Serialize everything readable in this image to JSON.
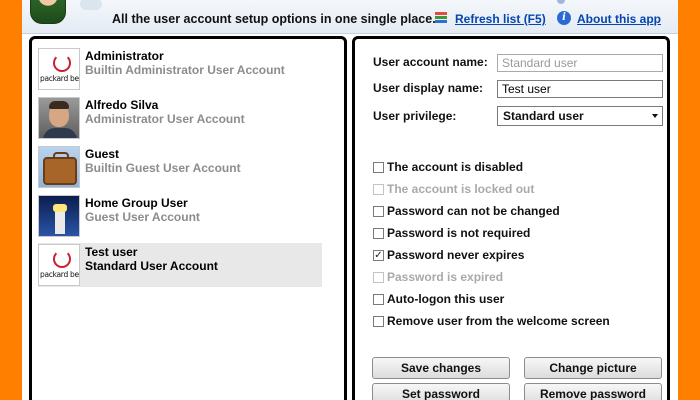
{
  "header": {
    "subtitle": "All the user account setup options in one single place.",
    "refresh_label": "Refresh list (F5)",
    "about_label": "About this app"
  },
  "users": [
    {
      "name": "Administrator",
      "description": "Builtin Administrator User Account",
      "image": "packard-bell-logo",
      "image_text": "packard bell",
      "selected": false
    },
    {
      "name": "Alfredo Silva",
      "description": "Administrator User Account",
      "image": "person-photo",
      "selected": false
    },
    {
      "name": "Guest",
      "description": "Builtin Guest User Account",
      "image": "suitcase",
      "selected": false
    },
    {
      "name": "Home Group User",
      "description": "Guest User Account",
      "image": "lighthouse",
      "selected": false
    },
    {
      "name": "Test user",
      "description": "Standard User Account",
      "image": "packard-bell-logo",
      "image_text": "packard bell",
      "selected": true
    }
  ],
  "details": {
    "account_name_label": "User account name:",
    "account_name_value": "Standard user",
    "display_name_label": "User display name:",
    "display_name_value": "Test user",
    "privilege_label": "User privilege:",
    "privilege_value": "Standard user"
  },
  "options": [
    {
      "label": "The account is disabled",
      "checked": false,
      "enabled": true
    },
    {
      "label": "The account is locked out",
      "checked": false,
      "enabled": false
    },
    {
      "label": "Password can not be changed",
      "checked": false,
      "enabled": true
    },
    {
      "label": "Password is not required",
      "checked": false,
      "enabled": true
    },
    {
      "label": "Password never expires",
      "checked": true,
      "enabled": true
    },
    {
      "label": "Password is expired",
      "checked": false,
      "enabled": false
    },
    {
      "label": "Auto-logon this user",
      "checked": false,
      "enabled": true
    },
    {
      "label": "Remove user from the welcome screen",
      "checked": false,
      "enabled": true
    }
  ],
  "buttons": {
    "save": "Save changes",
    "change_picture": "Change picture",
    "set_password": "Set password",
    "remove_password": "Remove password"
  },
  "colors": {
    "frame": "#ff8000",
    "link": "#0645ad",
    "disabled_text": "#a9a9a9"
  }
}
